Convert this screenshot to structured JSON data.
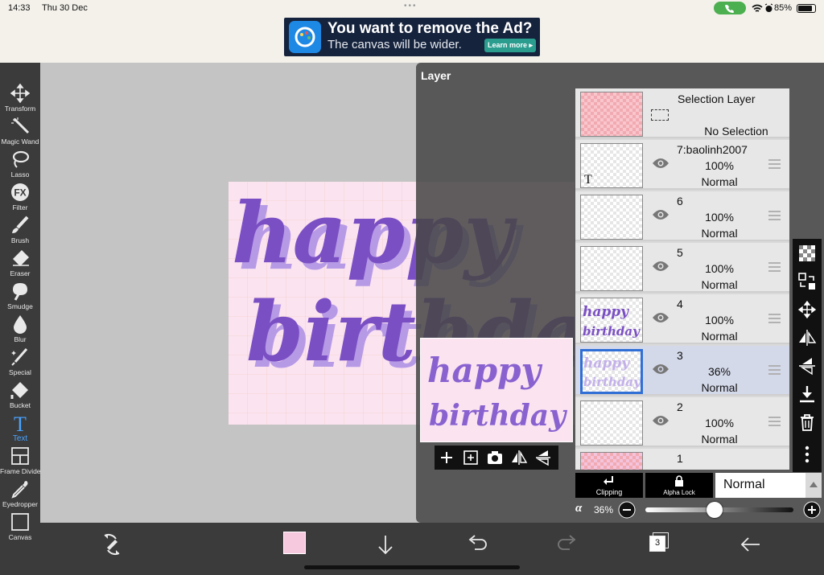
{
  "status_bar": {
    "time": "14:33",
    "date": "Thu 30 Dec",
    "battery": "85%",
    "colors": {
      "call_pill": "#4caf50"
    }
  },
  "ad": {
    "headline": "You want to remove the Ad?",
    "subline": "The canvas will be wider.",
    "button": "Learn more ▸"
  },
  "tools": [
    {
      "label": "Transform",
      "icon": "move-arrows-icon"
    },
    {
      "label": "Magic Wand",
      "icon": "magic-wand-icon"
    },
    {
      "label": "Lasso",
      "icon": "lasso-icon"
    },
    {
      "label": "Filter",
      "icon": "fx-icon"
    },
    {
      "label": "Brush",
      "icon": "brush-icon"
    },
    {
      "label": "Eraser",
      "icon": "eraser-icon"
    },
    {
      "label": "Smudge",
      "icon": "smudge-icon"
    },
    {
      "label": "Blur",
      "icon": "drop-icon"
    },
    {
      "label": "Special",
      "icon": "special-pen-icon"
    },
    {
      "label": "Bucket",
      "icon": "bucket-icon"
    },
    {
      "label": "Text",
      "icon": "text-t-icon",
      "active": true
    },
    {
      "label": "Frame Divider",
      "icon": "frame-divider-icon"
    },
    {
      "label": "Eyedropper",
      "icon": "eyedropper-icon"
    },
    {
      "label": "Canvas",
      "icon": "canvas-icon"
    }
  ],
  "layer_panel": {
    "title": "Layer",
    "selection_layer": {
      "name": "Selection Layer",
      "status": "No Selection"
    },
    "layers": [
      {
        "name": "7:baolinh2007",
        "opacity": "100%",
        "mode": "Normal",
        "text_layer": true
      },
      {
        "name": "6",
        "opacity": "100%",
        "mode": "Normal"
      },
      {
        "name": "5",
        "opacity": "100%",
        "mode": "Normal"
      },
      {
        "name": "4",
        "opacity": "100%",
        "mode": "Normal"
      },
      {
        "name": "3",
        "opacity": "36%",
        "mode": "Normal",
        "selected": true
      },
      {
        "name": "2",
        "opacity": "100%",
        "mode": "Normal"
      },
      {
        "name": "1",
        "opacity": "",
        "mode": ""
      }
    ],
    "clipping_label": "Clipping",
    "alpha_lock_label": "Alpha Lock",
    "blend_mode": "Normal",
    "alpha_symbol": "α",
    "opacity_value": "36%",
    "opacity_fraction": 0.36
  },
  "artwork": {
    "line1": "happy",
    "line2": "birthday",
    "colors": {
      "background": "#fbe3f0",
      "ink": "#7b4fc4",
      "ink_light": "#b79ae6"
    }
  },
  "bottom_bar": {
    "layer_count": "3",
    "color_swatch": "#f6c9df"
  }
}
